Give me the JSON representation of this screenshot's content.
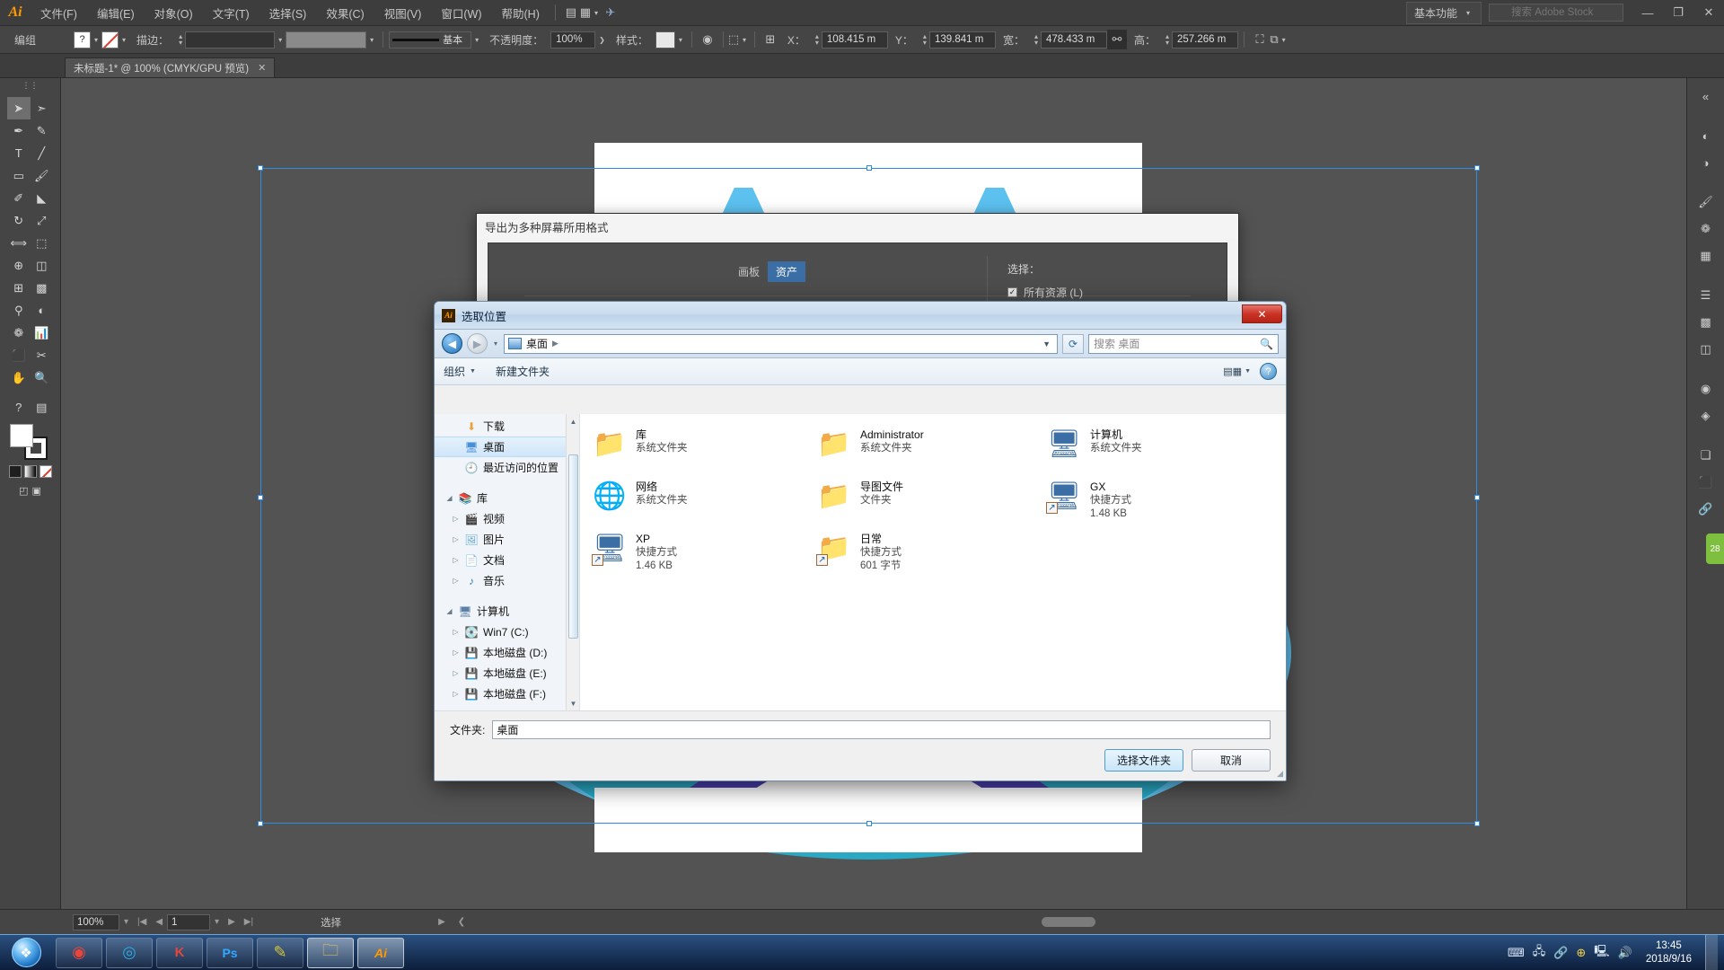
{
  "app": {
    "name": "Adobe Illustrator",
    "logo_text": "Ai",
    "menus": [
      "文件(F)",
      "编辑(E)",
      "对象(O)",
      "文字(T)",
      "选择(S)",
      "效果(C)",
      "视图(V)",
      "窗口(W)",
      "帮助(H)"
    ],
    "workspace": "基本功能",
    "stock_search_placeholder": "搜索 Adobe Stock",
    "window_buttons": [
      "—",
      "❐",
      "✕"
    ]
  },
  "control_bar": {
    "selection_label": "编组",
    "question_swatch": "?",
    "stroke_label": "描边：",
    "stroke_weight": "",
    "stroke_profile": "基本",
    "opacity_label": "不透明度：",
    "opacity_value": "100%",
    "style_label": "样式：",
    "x_label": "X：",
    "x_value": "108.415 m",
    "y_label": "Y：",
    "y_value": "139.841 m",
    "w_label": "宽：",
    "w_value": "478.433 m",
    "h_label": "高：",
    "h_value": "257.266 m"
  },
  "document_tab": {
    "label": "未标题-1* @ 100% (CMYK/GPU 预览)",
    "close": "✕"
  },
  "toolbar_left": {
    "header": "",
    "tools": [
      "selection-tool",
      "direct-selection-tool",
      "pen-tool",
      "add-anchor-tool",
      "type-tool",
      "line-tool",
      "rectangle-tool",
      "paintbrush-tool",
      "shaper-tool",
      "eraser-tool",
      "rotate-tool",
      "scale-tool",
      "width-tool",
      "free-transform-tool",
      "shape-builder-tool",
      "perspective-grid-tool",
      "mesh-tool",
      "gradient-tool",
      "eyedropper-tool",
      "blend-tool",
      "symbol-sprayer-tool",
      "column-graph-tool",
      "artboard-tool",
      "slice-tool",
      "hand-tool",
      "zoom-tool"
    ],
    "question_tool": "?"
  },
  "status_bar": {
    "zoom": "100%",
    "page": "1",
    "tool_text": "选择"
  },
  "export_dialog": {
    "title": "导出为多种屏幕所用格式",
    "tabs": [
      {
        "label": "画板",
        "active": false
      },
      {
        "label": "资产",
        "active": true
      }
    ],
    "select_label": "选择：",
    "all_assets_label": "所有资源 (L)",
    "all_assets_checked": true
  },
  "file_dialog": {
    "title": "选取位置",
    "close_label": "✕",
    "address": {
      "path": "桌面",
      "separator": "▶",
      "dropdown_caret": "▼"
    },
    "refresh_icon": "refresh-icon",
    "search_placeholder": "搜索 桌面",
    "toolbar": {
      "organize": "组织",
      "organize_caret": "▼",
      "new_folder": "新建文件夹",
      "view_caret": "▼",
      "help": "?"
    },
    "sidebar": [
      {
        "label": "下载",
        "icon": "downloads-icon",
        "indent": 1,
        "expander": "",
        "selected": false
      },
      {
        "label": "桌面",
        "icon": "desktop-icon",
        "indent": 1,
        "expander": "",
        "selected": true
      },
      {
        "label": "最近访问的位置",
        "icon": "recent-icon",
        "indent": 1,
        "expander": "",
        "selected": false
      },
      {
        "label": "",
        "icon": "",
        "indent": 0,
        "expander": "",
        "selected": false,
        "gap": true
      },
      {
        "label": "库",
        "icon": "library-icon",
        "indent": 0,
        "expander": "◢",
        "selected": false
      },
      {
        "label": "视频",
        "icon": "video-icon",
        "indent": 1,
        "expander": "▷",
        "selected": false
      },
      {
        "label": "图片",
        "icon": "pictures-icon",
        "indent": 1,
        "expander": "▷",
        "selected": false
      },
      {
        "label": "文档",
        "icon": "documents-icon",
        "indent": 1,
        "expander": "▷",
        "selected": false
      },
      {
        "label": "音乐",
        "icon": "music-icon",
        "indent": 1,
        "expander": "▷",
        "selected": false
      },
      {
        "label": "",
        "icon": "",
        "indent": 0,
        "expander": "",
        "selected": false,
        "gap": true
      },
      {
        "label": "计算机",
        "icon": "computer-icon",
        "indent": 0,
        "expander": "◢",
        "selected": false
      },
      {
        "label": "Win7 (C:)",
        "icon": "windows-drive-icon",
        "indent": 1,
        "expander": "▷",
        "selected": false
      },
      {
        "label": "本地磁盘 (D:)",
        "icon": "drive-icon",
        "indent": 1,
        "expander": "▷",
        "selected": false
      },
      {
        "label": "本地磁盘 (E:)",
        "icon": "drive-icon",
        "indent": 1,
        "expander": "▷",
        "selected": false
      },
      {
        "label": "本地磁盘 (F:)",
        "icon": "drive-icon",
        "indent": 1,
        "expander": "▷",
        "selected": false
      }
    ],
    "columns": [
      [
        {
          "name": "库",
          "type": "系统文件夹",
          "size": "",
          "icon": "library-folder-icon",
          "shortcut": false
        },
        {
          "name": "网络",
          "type": "系统文件夹",
          "size": "",
          "icon": "network-icon",
          "shortcut": false
        },
        {
          "name": "XP",
          "type": "快捷方式",
          "size": "1.46 KB",
          "icon": "computer-shortcut-icon",
          "shortcut": true
        }
      ],
      [
        {
          "name": "Administrator",
          "type": "系统文件夹",
          "size": "",
          "icon": "user-folder-icon",
          "shortcut": false
        },
        {
          "name": "导图文件",
          "type": "文件夹",
          "size": "",
          "icon": "folder-icon",
          "shortcut": false
        },
        {
          "name": "日常",
          "type": "快捷方式",
          "size": "601 字节",
          "icon": "folder-shortcut-icon",
          "shortcut": true
        }
      ],
      [
        {
          "name": "计算机",
          "type": "系统文件夹",
          "size": "",
          "icon": "computer-icon",
          "shortcut": false
        },
        {
          "name": "GX",
          "type": "快捷方式",
          "size": "1.48 KB",
          "icon": "computer-shortcut-icon",
          "shortcut": true
        }
      ]
    ],
    "footer": {
      "folder_label": "文件夹:",
      "folder_value": "桌面",
      "select_button": "选择文件夹",
      "cancel_button": "取消"
    }
  },
  "taskbar": {
    "start_label": "start-orb",
    "apps": [
      "chrome-icon",
      "360-browser-icon",
      "photoshop-icon",
      "kingsoft-icon",
      "explorer-icon",
      "illustrator-icon"
    ],
    "tray_icons": [
      "keyboard-icon",
      "network-icon",
      "link-icon",
      "shield-icon",
      "monitor-icon",
      "volume-icon"
    ],
    "time": "13:45",
    "date": "2018/9/16"
  },
  "colors": {
    "accent": "#3a6ea5",
    "ai_orange": "#ff9a00",
    "panel_bg": "#454545",
    "canvas_bg": "#535353",
    "art_light_blue": "#5cc1ef",
    "art_teal": "#2aa8c4",
    "art_purple": "#4a3fb0"
  }
}
